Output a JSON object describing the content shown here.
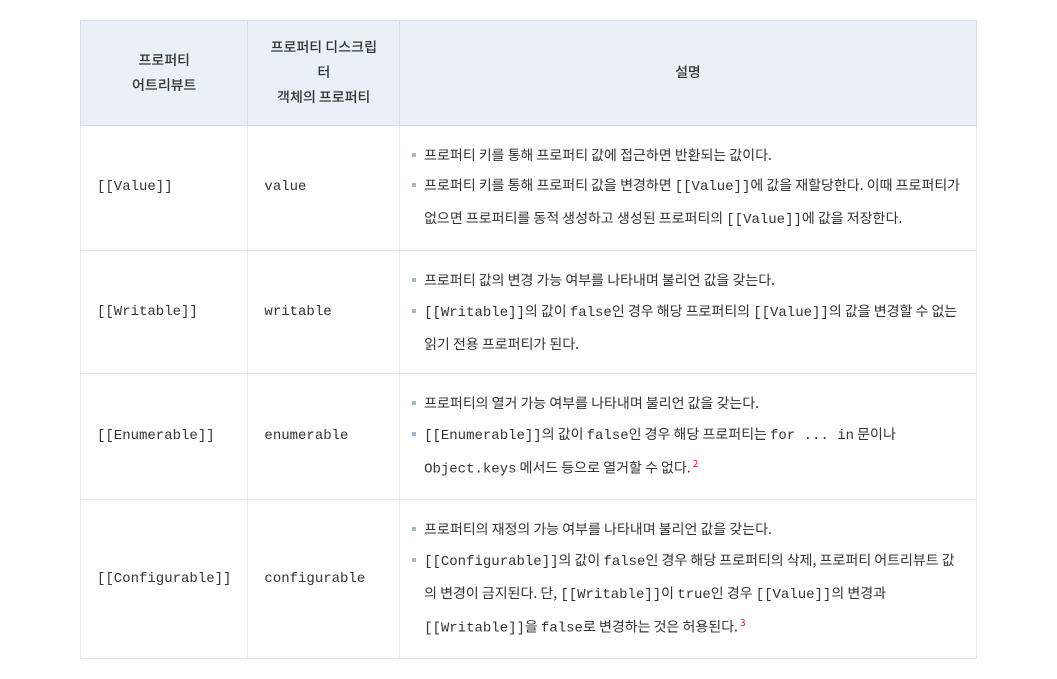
{
  "headers": {
    "col1_line1": "프로퍼티",
    "col1_line2": "어트리뷰트",
    "col2_line1": "프로퍼티 디스크립터",
    "col2_line2": "객체의 프로퍼티",
    "col3": "설명"
  },
  "rows": [
    {
      "attr": "[[Value]]",
      "desc": "value",
      "items": [
        {
          "pre": "프로퍼티 키를 통해 프로퍼티 값에 접근하면 반환되는 값이다."
        },
        {
          "pre": "프로퍼티 키를 통해 프로퍼티 값을 변경하면 ",
          "code1": "[[Value]]",
          "mid1": "에 값을 재할당한다. 이때 프로퍼티가 없으면 프로퍼티를 동적 생성하고 생성된 프로퍼티의 ",
          "code2": "[[Value]]",
          "post": "에 값을 저장한다."
        }
      ]
    },
    {
      "attr": "[[Writable]]",
      "desc": "writable",
      "items": [
        {
          "pre": "프로퍼티 값의 변경 가능 여부를 나타내며 불리언 값을 갖는다."
        },
        {
          "code1": "[[Writable]]",
          "mid1": "의 값이 ",
          "code2": "false",
          "mid2": "인 경우 해당 프로퍼티의 ",
          "code3": "[[Value]]",
          "post": "의 값을 변경할 수 없는 읽기 전용 프로퍼티가 된다."
        }
      ]
    },
    {
      "attr": "[[Enumerable]]",
      "desc": "enumerable",
      "items": [
        {
          "pre": "프로퍼티의 열거 가능 여부를 나타내며 불리언 값을 갖는다."
        },
        {
          "code1": "[[Enumerable]]",
          "mid1": "의 값이 ",
          "code2": "false",
          "mid2": "인 경우 해당 프로퍼티는 ",
          "code3": "for ... in",
          "mid3": " 문이나 ",
          "code4": "Object.keys",
          "post": " 메서드 등으로 열거할 수 없다.",
          "footnote": "2"
        }
      ]
    },
    {
      "attr": "[[Configurable]]",
      "desc": "configurable",
      "items": [
        {
          "pre": "프로퍼티의 재정의 가능 여부를 나타내며 불리언 값을 갖는다."
        },
        {
          "code1": "[[Configurable]]",
          "mid1": "의 값이 ",
          "code2": "false",
          "mid2": "인 경우 해당 프로퍼티의 삭제, 프로퍼티 어트리뷰트 값의 변경이 금지된다. 단, ",
          "code3": "[[Writable]]",
          "mid3": "이 ",
          "code4": "true",
          "mid4": "인 경우 ",
          "code5": "[[Value]]",
          "mid5": "의 변경과 ",
          "code6": "[[Writable]]",
          "mid6": "을 ",
          "code7": "false",
          "post": "로 변경하는 것은 허용된다.",
          "footnote": "3"
        }
      ]
    }
  ]
}
